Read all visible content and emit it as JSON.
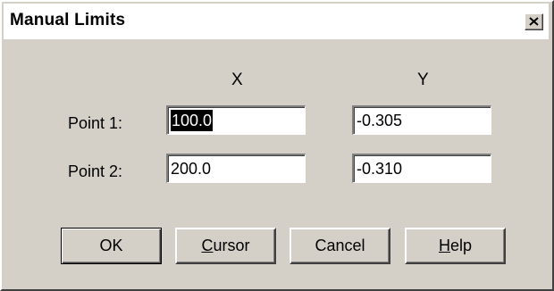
{
  "window": {
    "title": "Manual Limits"
  },
  "columns": {
    "x_header": "X",
    "y_header": "Y"
  },
  "points": [
    {
      "label": "Point 1:",
      "x": "100.0",
      "y": "-0.305"
    },
    {
      "label": "Point 2:",
      "x": "200.0",
      "y": "-0.310"
    }
  ],
  "buttons": {
    "ok": "OK",
    "cursor_mnemonic": "C",
    "cursor_rest": "ursor",
    "cancel": "Cancel",
    "help_mnemonic": "H",
    "help_rest": "elp"
  },
  "icons": {
    "close": "close-icon"
  },
  "colors": {
    "face": "#d4d0c8",
    "titlebar": "#ffffff",
    "selection": "#000000"
  }
}
